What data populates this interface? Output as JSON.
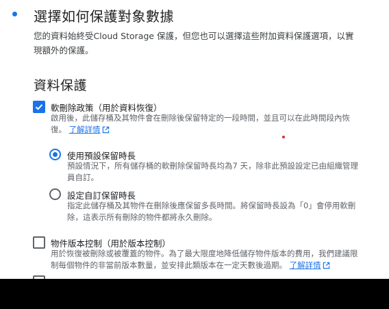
{
  "step": {
    "title": "選擇如何保護對象數據",
    "description": "您的資料始終受Cloud Storage 保護，但您也可以選擇這些附加資料保護選項，以實現額外的保護。"
  },
  "data_protection": {
    "title": "資料保護",
    "soft_delete": {
      "label": "軟刪除政策（用於資料恢復）",
      "checked": true,
      "description": "啟用後，此儲存桶及其物件會在刪除後保留特定的一段時間，並且可以在此時間段內恢復。",
      "learn_more": "了解詳情",
      "options": [
        {
          "label": "使用預設保留時長",
          "selected": true,
          "description": "預設情況下，所有儲存桶的軟刪除保留時長均為7 天，除非此預設設定已由組織管理員自訂。"
        },
        {
          "label": "設定自訂保留時長",
          "selected": false,
          "description": "指定此儲存桶及其物件在刪除後應保留多長時間。將保留時長設為「0」會停用軟刪除，這表示所有刪除的物件都將永久刪除。"
        }
      ]
    },
    "versioning": {
      "label": "物件版本控制（用於版本控制）",
      "checked": false,
      "description": "用於恢復被刪除或被覆蓋的物件。為了最大限度地降低儲存物件版本的費用，我們建議限制每個物件的非當前版本數量，並安排此類版本在一定天數後過期。",
      "learn_more": "了解詳情"
    }
  },
  "colors": {
    "accent": "#1a73e8",
    "text_primary": "#202124",
    "text_secondary": "#5f6368"
  }
}
